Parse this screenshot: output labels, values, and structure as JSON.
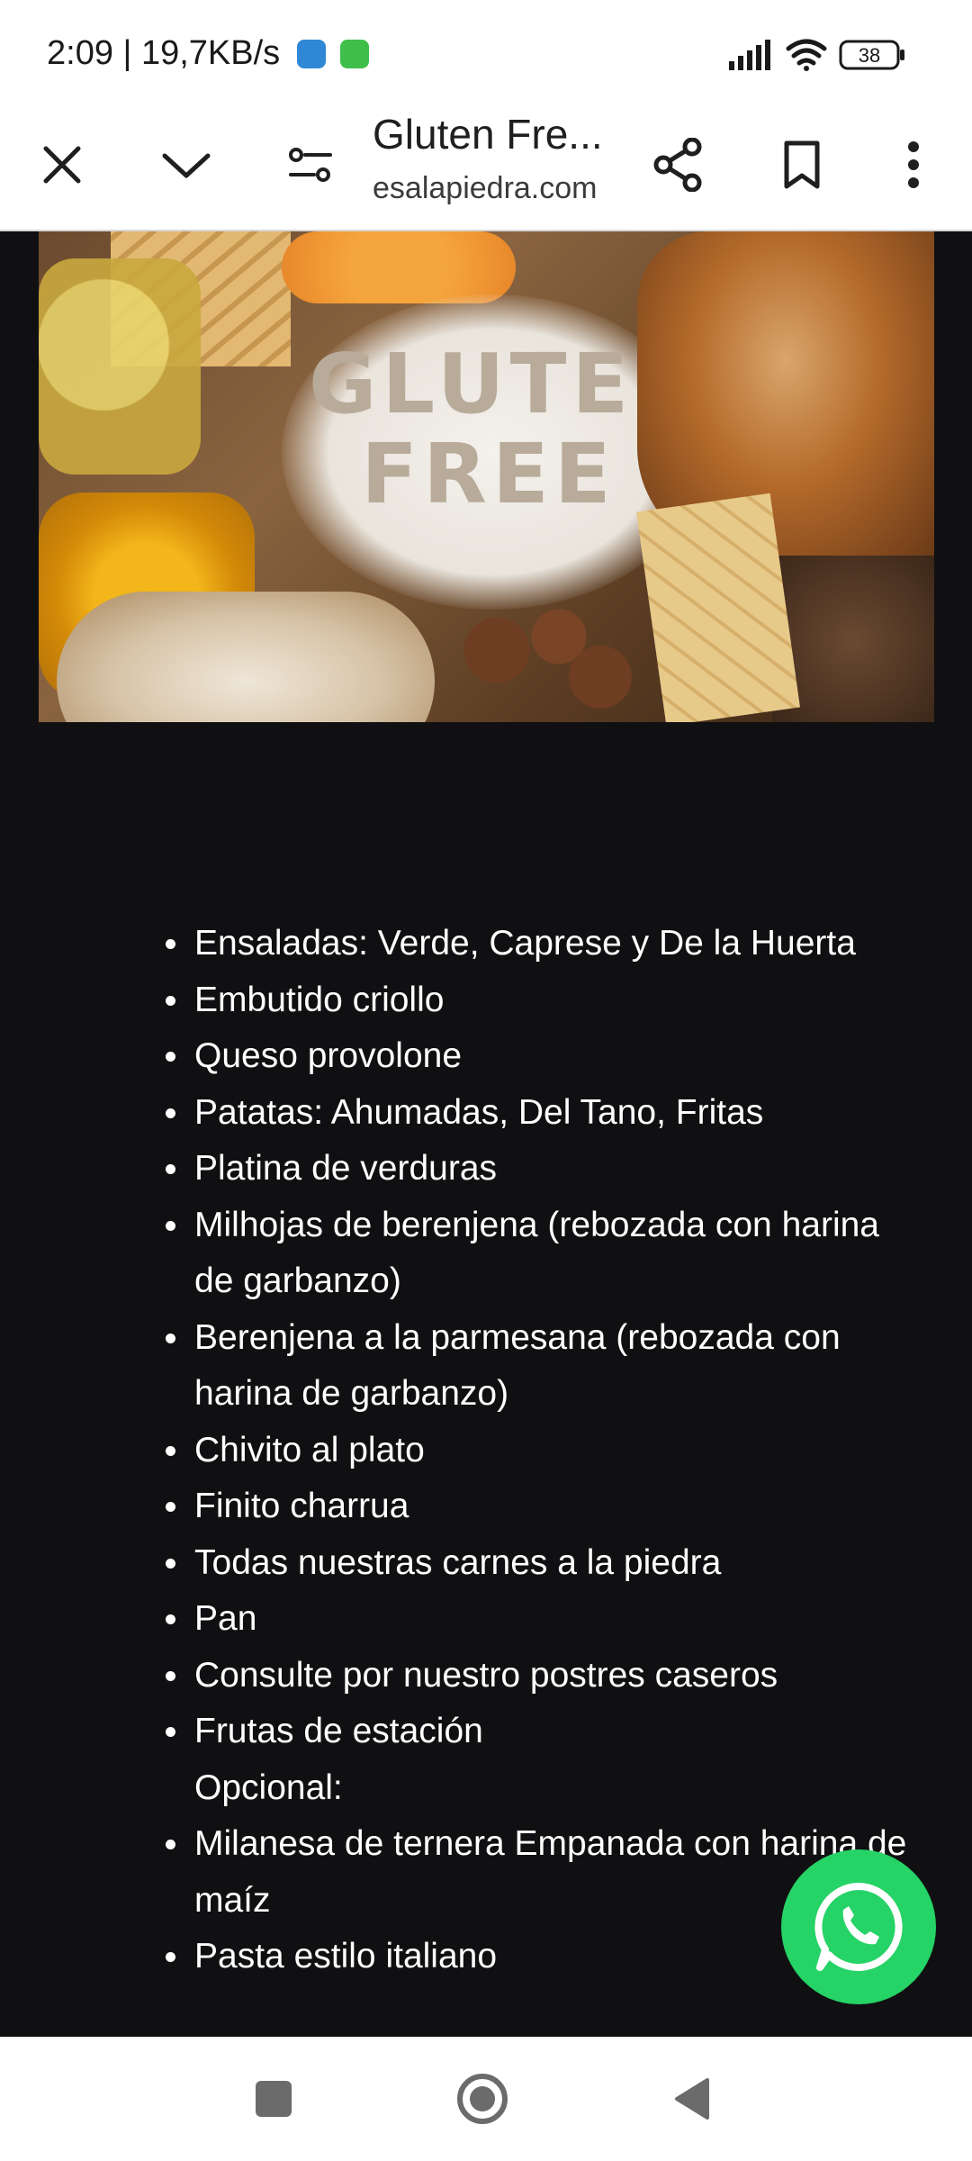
{
  "status_bar": {
    "time_speed": "2:09 | 19,7KB/s",
    "battery": "38",
    "icons": [
      "app-notification-icon",
      "android-notification-icon",
      "signal-icon",
      "wifi-icon",
      "battery-icon"
    ]
  },
  "toolbar": {
    "title": "Gluten Fre...",
    "url": "esalapiedra.com",
    "icons": [
      "close-icon",
      "chevron-down-icon",
      "page-settings-icon",
      "share-icon",
      "bookmark-icon",
      "more-vert-icon"
    ]
  },
  "hero": {
    "image_text": "GLUTEN FREE"
  },
  "menu": {
    "items": [
      {
        "text": "Ensaladas: Verde, Caprese y De la Huerta",
        "bullet": true
      },
      {
        "text": "Embutido criollo",
        "bullet": true
      },
      {
        "text": "Queso provolone",
        "bullet": true
      },
      {
        "text": "Patatas: Ahumadas, Del Tano, Fritas",
        "bullet": true
      },
      {
        "text": "Platina de verduras",
        "bullet": true
      },
      {
        "text": "Milhojas de berenjena (rebozada con harina de garbanzo)",
        "bullet": true
      },
      {
        "text": "Berenjena a la parmesana (rebozada con harina de garbanzo)",
        "bullet": true
      },
      {
        "text": "Chivito al plato",
        "bullet": true
      },
      {
        "text": "Finito charrua",
        "bullet": true
      },
      {
        "text": "Todas nuestras carnes a la piedra",
        "bullet": true
      },
      {
        "text": "Pan",
        "bullet": true
      },
      {
        "text": "Consulte por nuestro postres caseros",
        "bullet": true
      },
      {
        "text": "Frutas de estación",
        "bullet": true
      },
      {
        "text": "Opcional:",
        "bullet": false
      },
      {
        "text": "Milanesa de ternera Empanada con harina de maíz",
        "bullet": true
      },
      {
        "text": "Pasta estilo italiano",
        "bullet": true
      }
    ]
  },
  "fab": {
    "icon": "whatsapp-icon",
    "color": "#25d366"
  },
  "nav_bar": {
    "icons": [
      "recents-square-icon",
      "home-circle-icon",
      "back-triangle-icon"
    ]
  }
}
